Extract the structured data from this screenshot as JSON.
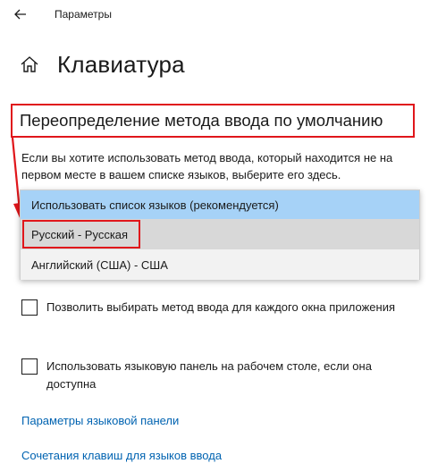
{
  "window": {
    "title": "Параметры"
  },
  "page": {
    "title": "Клавиатура"
  },
  "section": {
    "heading": "Переопределение метода ввода по умолчанию",
    "description": "Если вы хотите использовать метод ввода, который находится не на первом месте в вашем списке языков, выберите его здесь."
  },
  "dropdown": {
    "options": [
      {
        "label": "Использовать список языков (рекомендуется)"
      },
      {
        "label": "Русский - Русская"
      },
      {
        "label": "Английский (США) - США"
      }
    ]
  },
  "checkboxes": [
    {
      "label": "Позволить выбирать метод ввода для каждого окна приложения"
    },
    {
      "label": "Использовать языковую панель на рабочем столе, если она доступна"
    }
  ],
  "links": [
    {
      "label": "Параметры языковой панели"
    },
    {
      "label": "Сочетания клавиш для языков ввода"
    }
  ],
  "colors": {
    "accent_link": "#0063b1",
    "highlight_red": "#e0161b",
    "selected_option": "#a6d2f7"
  },
  "icons": {
    "back": "back-arrow-icon",
    "home": "home-icon"
  }
}
